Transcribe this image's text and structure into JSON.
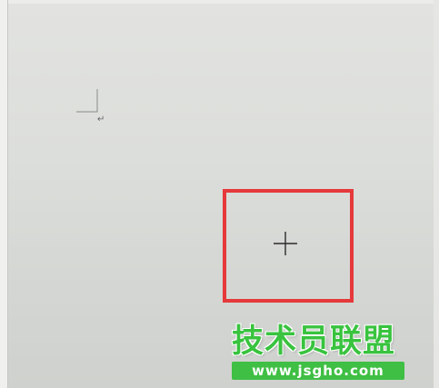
{
  "document": {
    "paragraph_mark": "↵"
  },
  "highlight": {
    "color": "#e5393b"
  },
  "cursor": {
    "type": "crosshair-icon"
  },
  "watermark": {
    "title": "技术员联盟",
    "url": "www.jsgho.com",
    "color": "#39c33f"
  }
}
